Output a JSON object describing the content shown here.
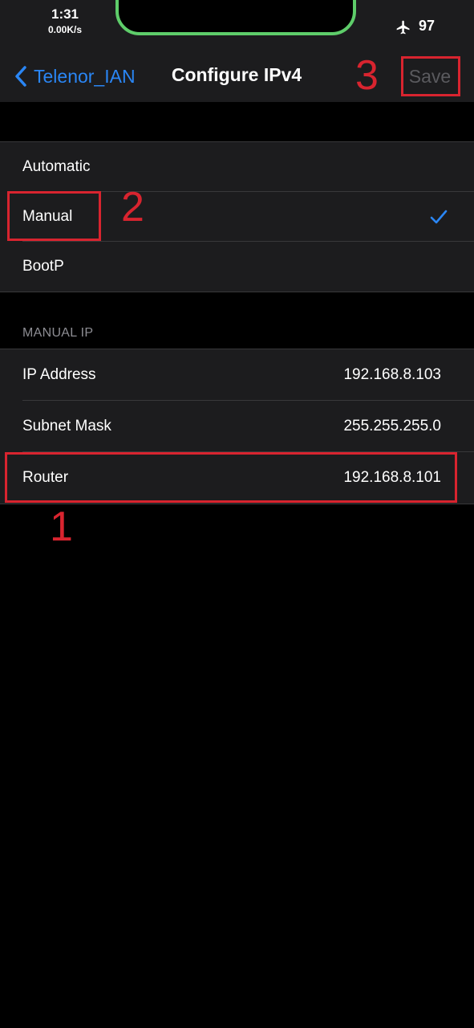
{
  "status_bar": {
    "time": "1:31",
    "network_speed": "0.00K/s",
    "battery_level": "97",
    "airplane_icon": "airplane-icon"
  },
  "nav": {
    "back_label": "Telenor_IAN",
    "title": "Configure IPv4",
    "save_label": "Save"
  },
  "modes": [
    {
      "label": "Automatic",
      "selected": false
    },
    {
      "label": "Manual",
      "selected": true
    },
    {
      "label": "BootP",
      "selected": false
    }
  ],
  "manual_ip": {
    "header": "MANUAL IP",
    "rows": [
      {
        "label": "IP Address",
        "value": "192.168.8.103"
      },
      {
        "label": "Subnet Mask",
        "value": "255.255.255.0"
      },
      {
        "label": "Router",
        "value": "192.168.8.101"
      }
    ]
  },
  "annotations": [
    "1",
    "2",
    "3"
  ],
  "colors": {
    "accent": "#2a86f5",
    "annotation": "#d8242f",
    "island_outline": "#5ecd6a",
    "cell_background": "#1c1c1e",
    "save_disabled": "#5a5a5e"
  }
}
